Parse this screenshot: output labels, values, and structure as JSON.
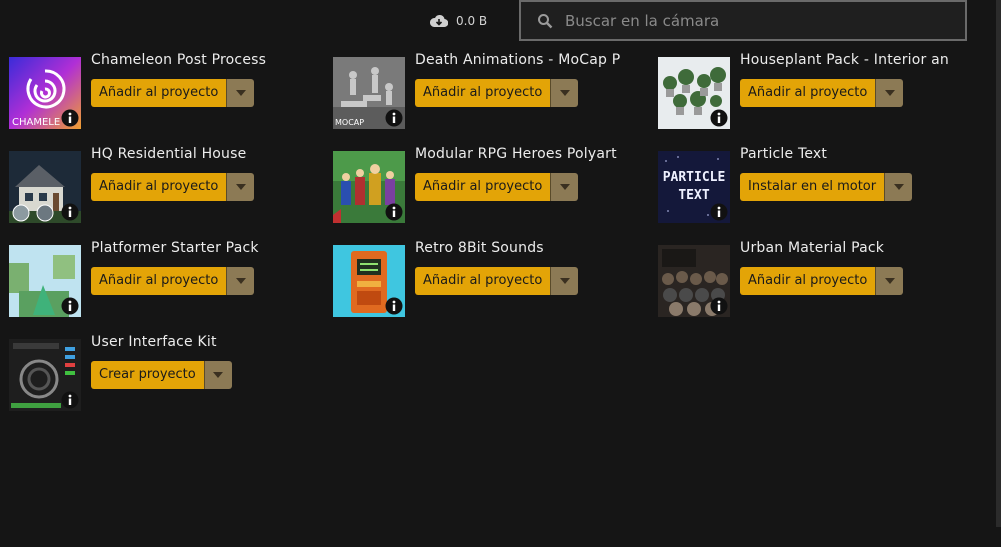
{
  "topbar": {
    "storage_label": "0.0 B",
    "search_placeholder": "Buscar en la cámara"
  },
  "items": [
    {
      "title": "Chameleon Post Process",
      "action": "Añadir al proyecto",
      "thumb_text": "CHAMELE"
    },
    {
      "title": "Death Animations - MoCap P",
      "action": "Añadir al proyecto",
      "thumb_text": "MOCAP"
    },
    {
      "title": "Houseplant Pack - Interior an",
      "action": "Añadir al proyecto"
    },
    {
      "title": "HQ Residential House",
      "action": "Añadir al proyecto"
    },
    {
      "title": "Modular RPG Heroes Polyart",
      "action": "Añadir al proyecto"
    },
    {
      "title": "Particle Text",
      "action": "Instalar en el motor",
      "thumb_text": "PARTICLE TEXT"
    },
    {
      "title": "Platformer Starter Pack",
      "action": "Añadir al proyecto"
    },
    {
      "title": "Retro 8Bit Sounds",
      "action": "Añadir al proyecto"
    },
    {
      "title": "Urban Material Pack",
      "action": "Añadir al proyecto"
    },
    {
      "title": "User Interface Kit",
      "action": "Crear proyecto"
    }
  ],
  "colors": {
    "accent": "#e3a407",
    "dropdown": "#8c7a55",
    "background": "#151515"
  },
  "icons": {
    "storage": "cloud-download-icon",
    "search": "search-icon",
    "info": "info-icon",
    "dropdown": "chevron-down-icon"
  }
}
